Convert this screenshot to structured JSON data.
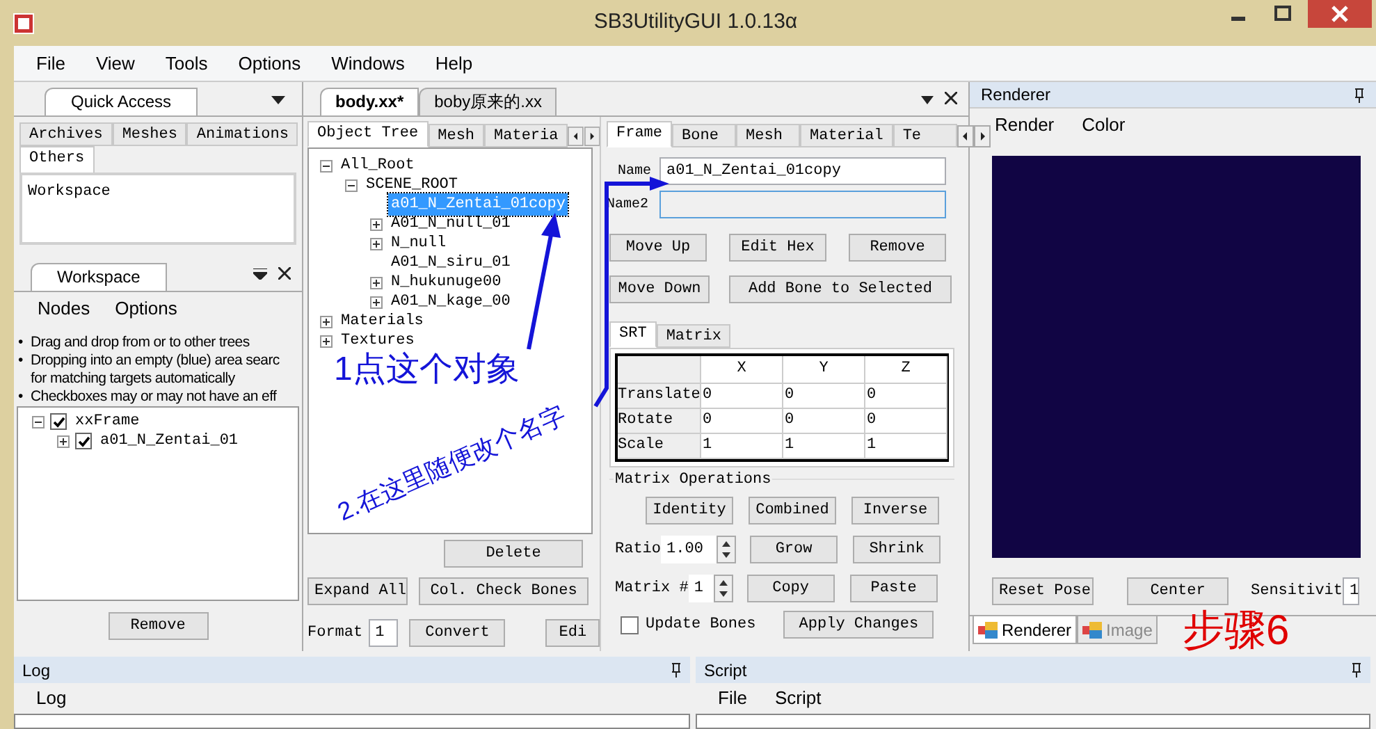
{
  "window": {
    "title": "SB3UtilityGUI 1.0.13α"
  },
  "menu": [
    "File",
    "View",
    "Tools",
    "Options",
    "Windows",
    "Help"
  ],
  "quick_access": {
    "tab": "Quick Access",
    "tabs": [
      {
        "label": "Archives",
        "selected": false
      },
      {
        "label": "Meshes",
        "selected": false
      },
      {
        "label": "Animations",
        "selected": false
      },
      {
        "label": "Others",
        "selected": true
      }
    ],
    "items": [
      "Workspace"
    ]
  },
  "workspace": {
    "tab": "Workspace",
    "menu": [
      "Nodes",
      "Options"
    ],
    "hints": [
      {
        "bullet": "•",
        "lines": [
          "Drag and drop from or to other trees"
        ]
      },
      {
        "bullet": "•",
        "lines": [
          "Dropping into an empty (blue) area searc",
          "for matching targets automatically"
        ]
      },
      {
        "bullet": "•",
        "lines": [
          "Checkboxes may or may not have an eff"
        ]
      }
    ],
    "tree": [
      {
        "label": "xxFrame",
        "checked": true,
        "expanded": true,
        "children": [
          {
            "label": "a01_N_Zentai_01",
            "checked": true,
            "expanded": false
          }
        ]
      }
    ],
    "remove_button": "Remove"
  },
  "document": {
    "tabs": [
      {
        "label": "body.xx*",
        "selected": true
      },
      {
        "label": "boby原来的.xx",
        "selected": false
      }
    ],
    "subtabs": [
      {
        "label": "Object Tree",
        "selected": true
      },
      {
        "label": "Mesh",
        "selected": false
      },
      {
        "label": "Materia",
        "selected": false
      }
    ],
    "tree": [
      {
        "label": "All_Root",
        "expanded": true,
        "children": [
          {
            "label": "SCENE_ROOT",
            "expanded": true,
            "children": [
              {
                "label": "a01_N_Zentai_01copy",
                "selected": true
              },
              {
                "label": "A01_N_null_01",
                "expanded": false,
                "selected": false
              },
              {
                "label": "N_null",
                "expanded": false,
                "selected": false
              },
              {
                "label": "A01_N_siru_01",
                "selected": false
              },
              {
                "label": "N_hukunuge00",
                "expanded": false,
                "selected": false
              },
              {
                "label": "A01_N_kage_00",
                "expanded": false,
                "selected": false
              }
            ]
          }
        ]
      },
      {
        "label": "Materials",
        "expanded": false
      },
      {
        "label": "Textures",
        "expanded": false
      }
    ],
    "delete_button": "Delete",
    "expand_button": "Expand All",
    "check_bones_button": "Col. Check Bones",
    "format_label": "Format",
    "format_value": "1",
    "convert_button": "Convert",
    "edit_button": "Edi"
  },
  "frame_panel": {
    "tabs": [
      {
        "label": "Frame",
        "selected": true
      },
      {
        "label": "Bone",
        "selected": false
      },
      {
        "label": "Mesh",
        "selected": false
      },
      {
        "label": "Material",
        "selected": false
      },
      {
        "label": "Te",
        "selected": false
      }
    ],
    "name_label": "Name",
    "name_value": "a01_N_Zentai_01copy",
    "name2_label": "Name2",
    "buttons_row1": [
      "Move Up",
      "Edit Hex",
      "Remove"
    ],
    "move_down": "Move Down",
    "add_bone": "Add Bone to Selected",
    "srt_tabs": [
      {
        "label": "SRT",
        "selected": true
      },
      {
        "label": "Matrix",
        "selected": false
      }
    ],
    "table": {
      "columns": [
        "X",
        "Y",
        "Z"
      ],
      "rows": [
        {
          "label": "Translate",
          "values": [
            "0",
            "0",
            "0"
          ]
        },
        {
          "label": "Rotate",
          "values": [
            "0",
            "0",
            "0"
          ]
        },
        {
          "label": "Scale",
          "values": [
            "1",
            "1",
            "1"
          ]
        }
      ]
    },
    "matrix_ops": {
      "title": "Matrix Operations",
      "buttons_row1": [
        "Identity",
        "Combined",
        "Inverse"
      ],
      "ratio_label": "Ratio",
      "ratio_value": "1.00",
      "buttons_row2": [
        "Grow",
        "Shrink"
      ],
      "matrix_label": "Matrix #",
      "matrix_value": "1",
      "buttons_row3": [
        "Copy",
        "Paste"
      ]
    },
    "update_bones": {
      "label": "Update Bones",
      "checked": false
    },
    "apply_button": "Apply Changes"
  },
  "renderer": {
    "title": "Renderer",
    "menu": [
      "Render",
      "Color"
    ],
    "buttons": [
      "Reset Pose",
      "Center"
    ],
    "sensitivity_label": "Sensitivit",
    "sensitivity_value": "1",
    "tabs": [
      {
        "label": "Renderer",
        "selected": true
      },
      {
        "label": "Image",
        "selected": false
      }
    ]
  },
  "log": {
    "title": "Log",
    "menu": [
      "Log"
    ]
  },
  "script": {
    "title": "Script",
    "menu": [
      "File",
      "Script"
    ]
  },
  "annotations": [
    {
      "kind": "label",
      "text": "1点这个对象"
    },
    {
      "kind": "diagonal",
      "text": "2.在这里随便改个名字"
    },
    {
      "kind": "step",
      "text": "步骤6"
    }
  ]
}
